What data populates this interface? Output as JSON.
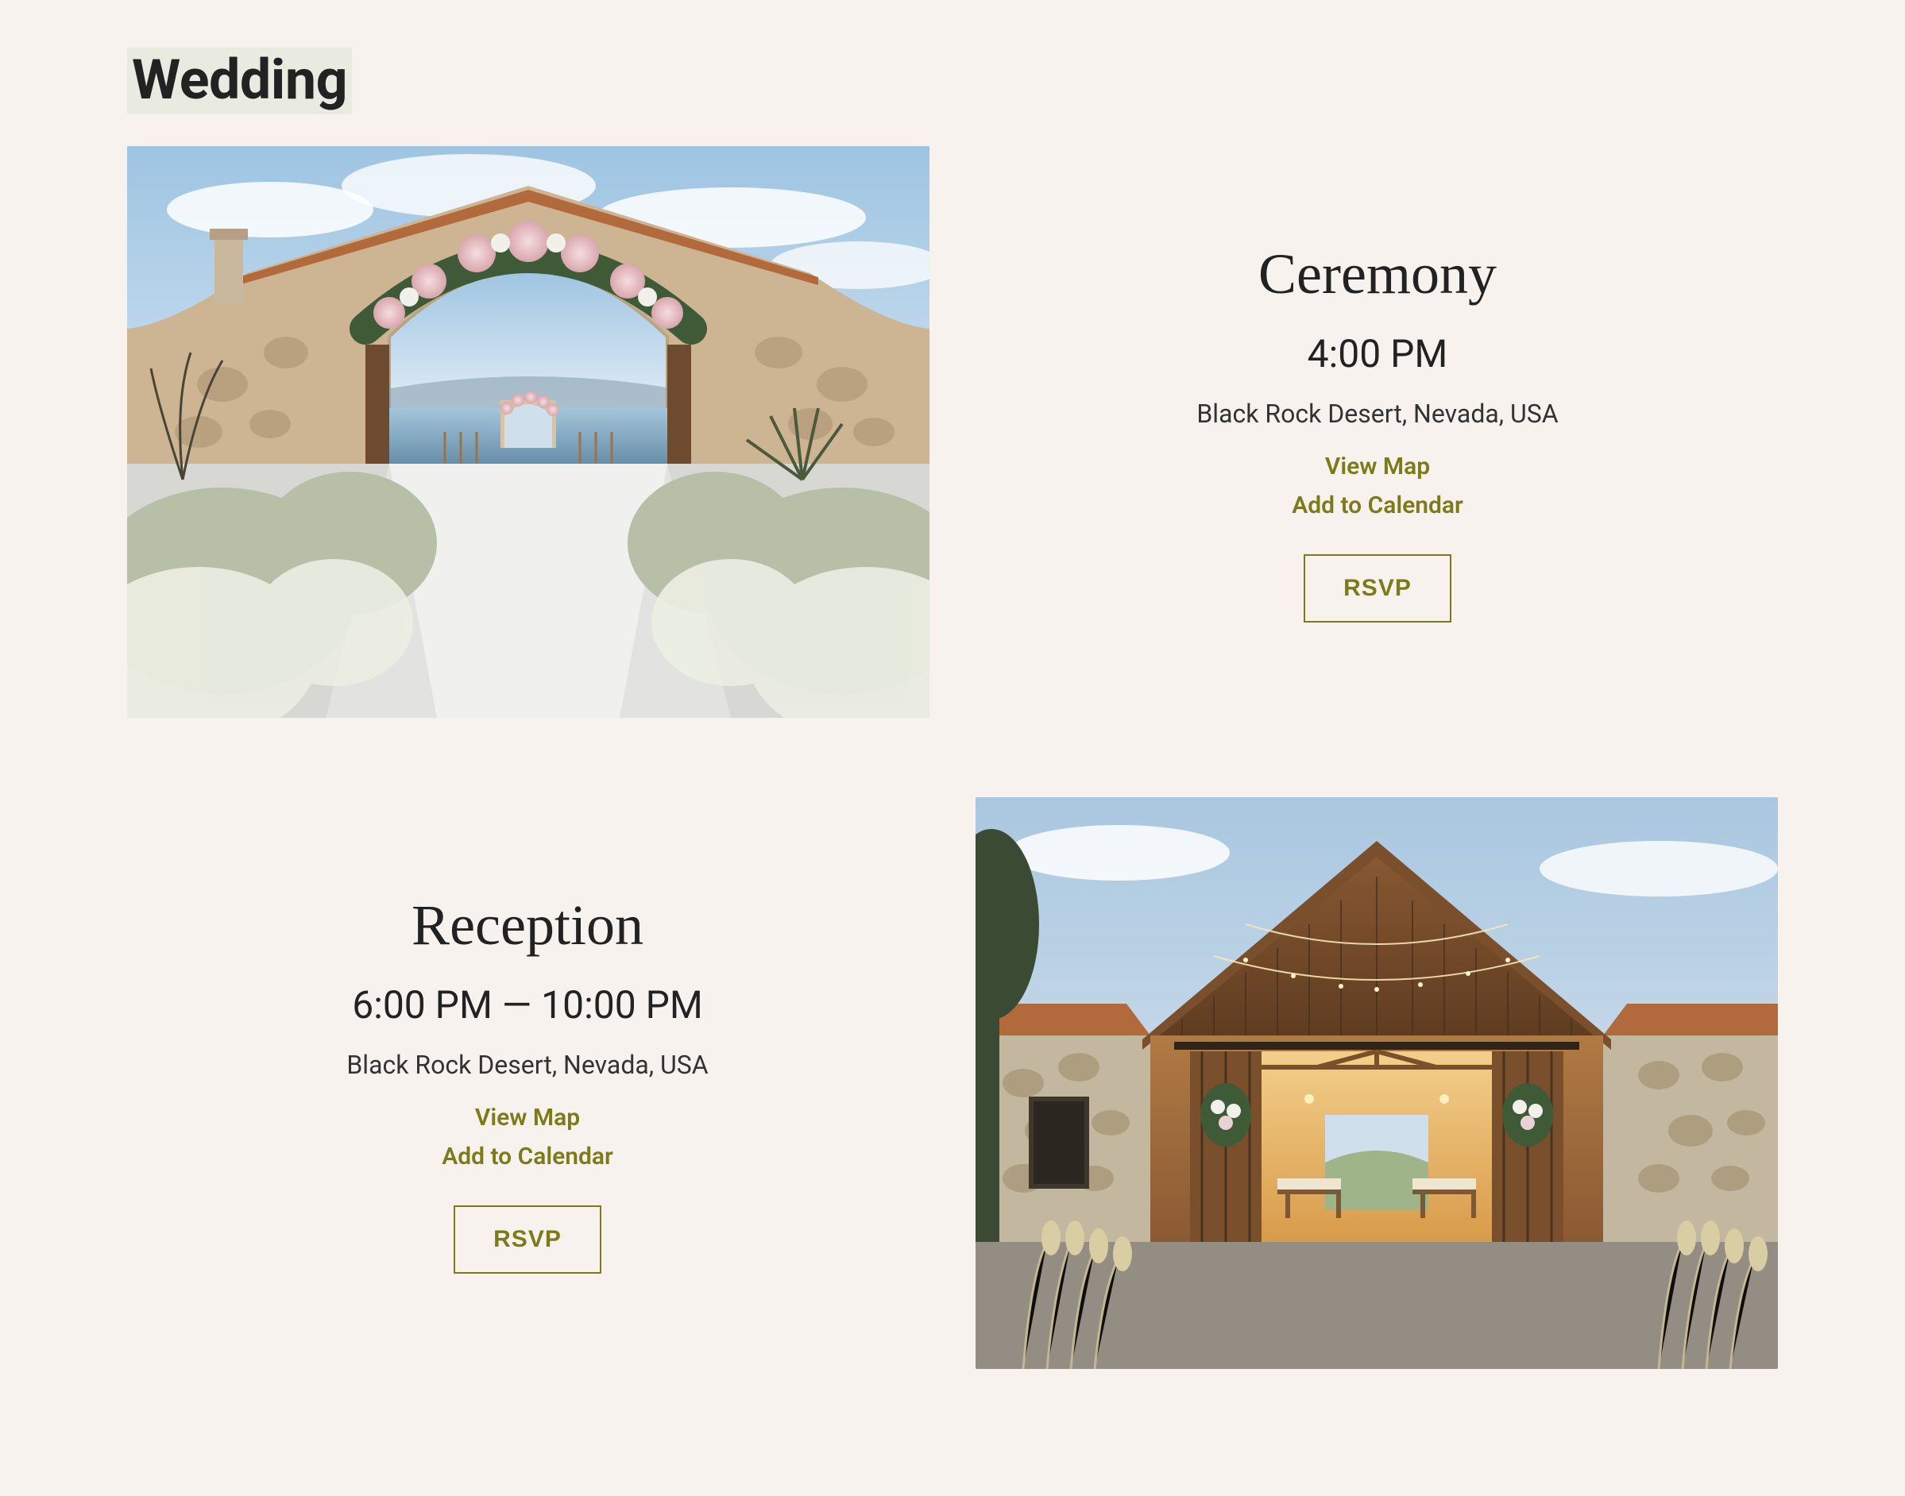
{
  "pageHeading": "Wedding",
  "events": [
    {
      "title": "Ceremony",
      "time": "4:00 PM",
      "location": "Black Rock Desert, Nevada, USA",
      "viewMap": "View Map",
      "addCalendar": "Add to Calendar",
      "rsvp": "RSVP"
    },
    {
      "title": "Reception",
      "time": "6:00 PM — 10:00 PM",
      "location": "Black Rock Desert, Nevada, USA",
      "viewMap": "View Map",
      "addCalendar": "Add to Calendar",
      "rsvp": "RSVP"
    }
  ]
}
